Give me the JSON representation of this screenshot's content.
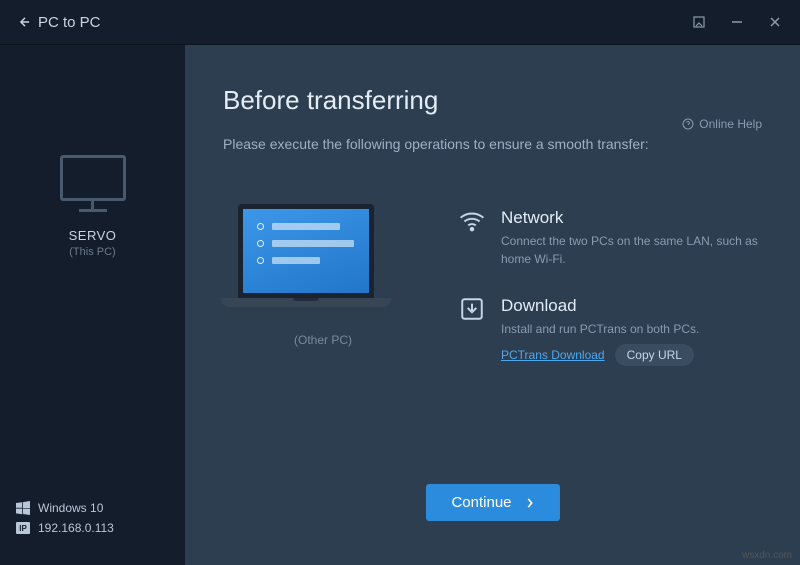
{
  "titlebar": {
    "back_label": "PC to PC"
  },
  "sidebar": {
    "pc_name": "SERVO",
    "pc_sub": "(This PC)",
    "os": "Windows 10",
    "ip": "192.168.0.113"
  },
  "main": {
    "title": "Before transferring",
    "subtitle": "Please execute the following operations to ensure a smooth transfer:",
    "help_label": "Online Help",
    "laptop_label": "(Other PC)",
    "steps": {
      "network": {
        "title": "Network",
        "desc": "Connect the two PCs on the same LAN, such as home Wi-Fi."
      },
      "download": {
        "title": "Download",
        "desc": "Install and run PCTrans on both PCs.",
        "link_label": "PCTrans Download",
        "copy_label": "Copy URL"
      }
    },
    "continue_label": "Continue"
  },
  "watermark": "wsxdn.com"
}
